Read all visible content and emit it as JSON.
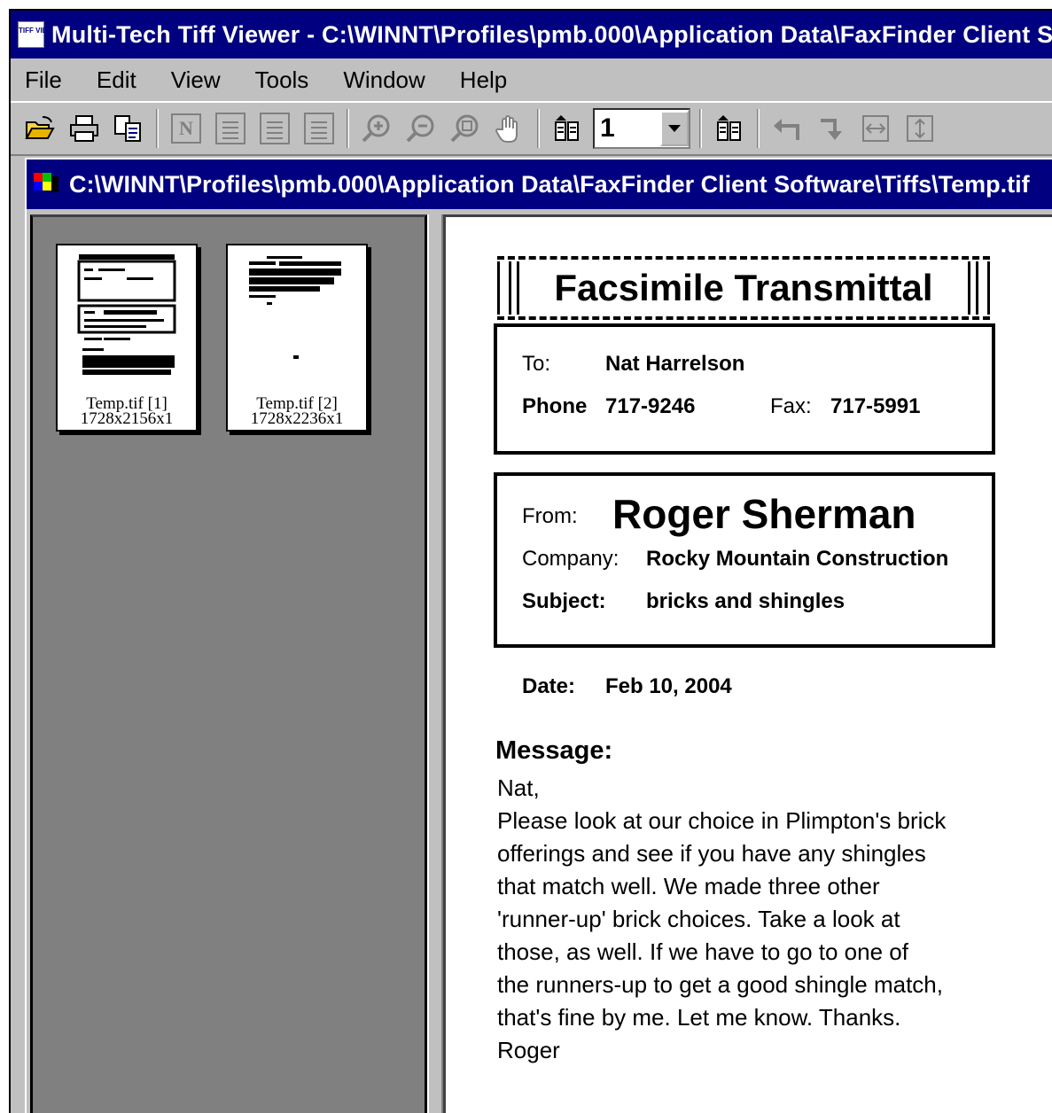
{
  "window": {
    "icon_text": "TIFF VIEW",
    "title": "Multi-Tech Tiff Viewer - C:\\WINNT\\Profiles\\pmb.000\\Application Data\\FaxFinder Client Software\\Tiffs\\Temp.tif"
  },
  "menu": {
    "file": "File",
    "edit": "Edit",
    "view": "View",
    "tools": "Tools",
    "window": "Window",
    "help": "Help"
  },
  "toolbar": {
    "page_value": "1",
    "icons": [
      "open-icon",
      "print-icon",
      "copy-icon",
      "normal-view-icon",
      "fit-width-icon",
      "fit-height-icon",
      "fit-page-icon",
      "zoom-in-icon",
      "zoom-out-icon",
      "zoom-area-icon",
      "pan-icon",
      "prev-page-icon",
      "next-page-icon",
      "rotate-left-icon",
      "rotate-right-icon",
      "flip-horizontal-icon",
      "flip-vertical-icon"
    ]
  },
  "document_window": {
    "title": "C:\\WINNT\\Profiles\\pmb.000\\Application Data\\FaxFinder Client Software\\Tiffs\\Temp.tif"
  },
  "thumbnails": [
    {
      "name": "Temp.tif [1]",
      "size": "1728x2156x1"
    },
    {
      "name": "Temp.tif [2]",
      "size": "1728x2236x1"
    }
  ],
  "fax": {
    "banner": "Facsimile Transmittal",
    "to_label": "To:",
    "to_value": "Nat Harrelson",
    "phone_label": "Phone",
    "phone_value": "717-9246",
    "fax_label": "Fax:",
    "fax_value": "717-5991",
    "from_label": "From:",
    "from_value": "Roger Sherman",
    "company_label": "Company:",
    "company_value": "Rocky Mountain Construction",
    "subject_label": "Subject:",
    "subject_value": "bricks and shingles",
    "date_label": "Date:",
    "date_value": "Feb 10, 2004",
    "message_label": "Message:",
    "message_lines": [
      "Nat,",
      "Please look at our choice in Plimpton's brick",
      "offerings and see if you have any shingles",
      "that match well.  We made three other",
      "'runner-up' brick choices.  Take a look at",
      "those, as  well.  If we have to go to one of",
      "the runners-up to get a good shingle match,",
      "that's fine by  me.  Let me know. Thanks.",
      "Roger"
    ]
  }
}
